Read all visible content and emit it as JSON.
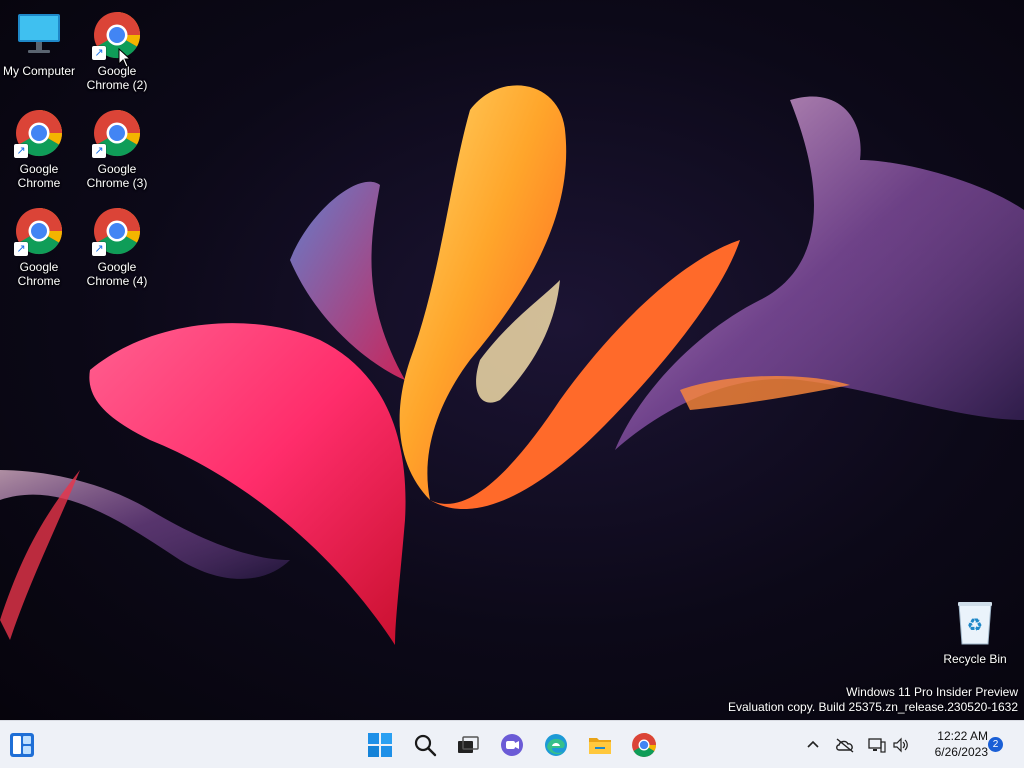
{
  "desktop": {
    "icons": [
      {
        "label": "My Computer",
        "icon": "computer-icon"
      },
      {
        "label": "Google Chrome (2)",
        "icon": "chrome-icon"
      },
      {
        "label": "Google Chrome",
        "icon": "chrome-icon"
      },
      {
        "label": "Google Chrome (3)",
        "icon": "chrome-icon"
      },
      {
        "label": "Google Chrome",
        "icon": "chrome-icon"
      },
      {
        "label": "Google Chrome (4)",
        "icon": "chrome-icon"
      },
      {
        "label": "Recycle Bin",
        "icon": "recycle-bin-icon"
      }
    ],
    "watermark": {
      "line1": "Windows 11 Pro Insider Preview",
      "line2": "Evaluation copy. Build 25375.zn_release.230520-1632"
    }
  },
  "taskbar": {
    "left": {
      "widgets": "widgets-icon"
    },
    "apps": [
      "start-icon",
      "search-icon",
      "task-view-icon",
      "chat-icon",
      "edge-icon",
      "file-explorer-icon",
      "chrome-icon"
    ],
    "tray": [
      "chevron-up-icon",
      "onedrive-icon",
      "network-icon",
      "volume-icon"
    ],
    "clock": {
      "time": "12:22 AM",
      "date": "6/26/2023"
    },
    "notification_count": "2"
  },
  "colors": {
    "taskbar_bg": "#eef1f7",
    "accent": "#1a5fd6",
    "chrome_red": "#db4437",
    "chrome_yellow": "#f4b400",
    "chrome_green": "#0f9d58",
    "chrome_blue": "#4285f4"
  }
}
